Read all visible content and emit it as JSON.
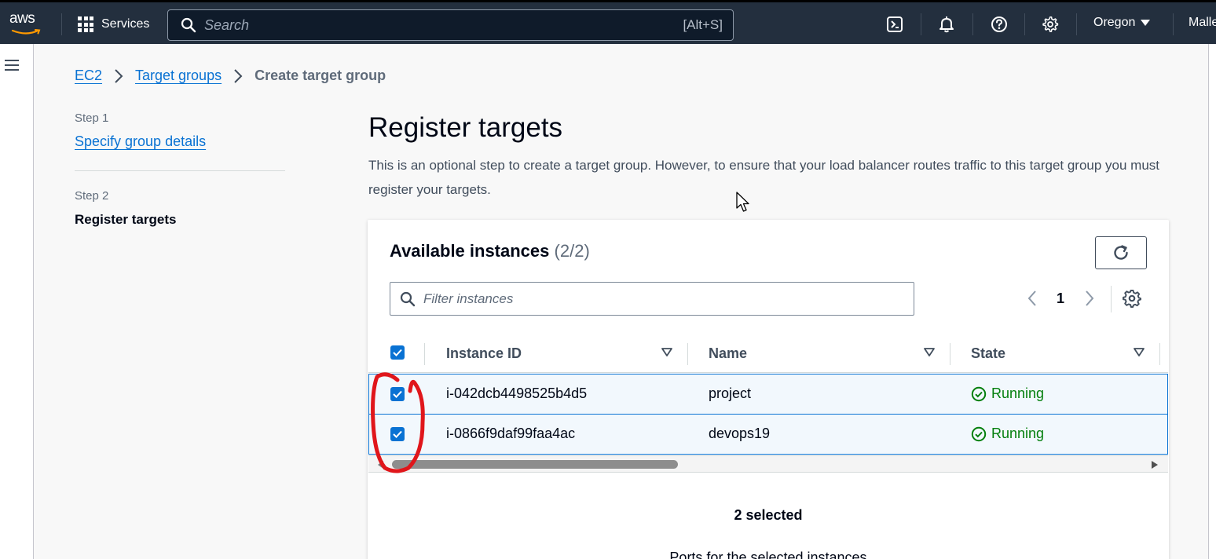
{
  "topnav": {
    "logo_text": "aws",
    "services_label": "Services",
    "search_placeholder": "Search",
    "search_shortcut": "[Alt+S]",
    "region": "Oregon",
    "user": "Malle",
    "icons": [
      "cloudshell-icon",
      "bell-icon",
      "help-icon",
      "gear-icon"
    ]
  },
  "breadcrumb": {
    "items": [
      "EC2",
      "Target groups"
    ],
    "current": "Create target group"
  },
  "steps": [
    {
      "label": "Step 1",
      "title": "Specify group details"
    },
    {
      "label": "Step 2",
      "title": "Register targets"
    }
  ],
  "page": {
    "title": "Register targets",
    "description": "This is an optional step to create a target group. However, to ensure that your load balancer routes traffic to this target group you must register your targets."
  },
  "panel": {
    "title": "Available instances",
    "count": "(2/2)",
    "filter_placeholder": "Filter instances",
    "page_number": "1",
    "columns": [
      "Instance ID",
      "Name",
      "State"
    ],
    "rows": [
      {
        "instance_id": "i-042dcb4498525b4d5",
        "name": "project",
        "state": "Running",
        "selected": true
      },
      {
        "instance_id": "i-0866f9daf99faa4ac",
        "name": "devops19",
        "state": "Running",
        "selected": true
      }
    ],
    "selected_text": "2 selected",
    "ports_label": "Ports for the selected instances"
  },
  "colors": {
    "nav_bg": "#232f3e",
    "link": "#0972d3",
    "success": "#037f0c",
    "annotation": "#e0161b"
  }
}
